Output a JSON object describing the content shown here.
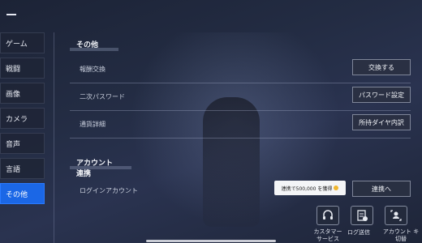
{
  "sidebar": {
    "items": [
      {
        "label": "ゲーム"
      },
      {
        "label": "戦闘"
      },
      {
        "label": "画像"
      },
      {
        "label": "カメラ"
      },
      {
        "label": "音声"
      },
      {
        "label": "言語"
      },
      {
        "label": "その他",
        "active": true
      }
    ]
  },
  "sections": {
    "other": {
      "title": "その他",
      "rows": [
        {
          "label": "報酬交換",
          "button": "交換する"
        },
        {
          "label": "二次パスワード",
          "button": "パスワード設定"
        },
        {
          "label": "通貨詳細",
          "button": "所持ダイヤ内訳"
        }
      ]
    },
    "account": {
      "title": "アカウント連携",
      "rows": [
        {
          "label": "ログインアカウント",
          "button": "連携へ"
        }
      ],
      "tooltip": "連携で500,000 を獲得"
    }
  },
  "bottom_buttons": [
    {
      "label": "カスタマー\nサービス",
      "icon": "headset-icon"
    },
    {
      "label": "ログ送信",
      "icon": "document-send-icon"
    },
    {
      "label": "アカウント キ\n切替",
      "icon": "account-switch-icon"
    }
  ],
  "colors": {
    "active_tab": "#1b67e6",
    "background": "#232c43"
  }
}
